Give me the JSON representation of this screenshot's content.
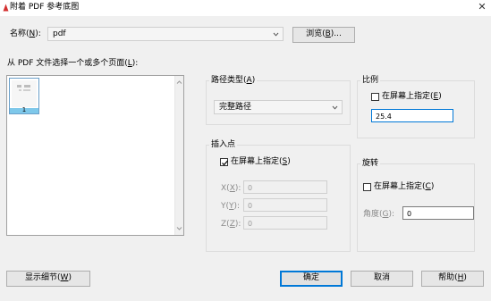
{
  "window": {
    "title": "附着 PDF 参考底图",
    "close_glyph": "✕"
  },
  "name_field": {
    "label": "名称(",
    "mnemonic": "N",
    "label_suffix": "):",
    "value": "pdf"
  },
  "browse_button": {
    "label": "浏览(",
    "mnemonic": "B",
    "suffix": ")..."
  },
  "pages": {
    "label": "从 PDF 文件选择一个或多个页面(",
    "mnemonic": "L",
    "suffix": "):",
    "thumbnails": [
      {
        "page_number": "1"
      }
    ]
  },
  "path_type": {
    "title": "路径类型(",
    "mnemonic": "A",
    "suffix": ")",
    "selected": "完整路径"
  },
  "scale": {
    "title": "比例",
    "specify_label": "在屏幕上指定(",
    "specify_mnemonic": "E",
    "specify_suffix": ")",
    "specify_checked": false,
    "value": "25.4"
  },
  "insertion_point": {
    "title": "插入点",
    "specify_label": "在屏幕上指定(",
    "specify_mnemonic": "S",
    "specify_suffix": ")",
    "specify_checked": true,
    "x": {
      "label": "X(",
      "mnemonic": "X",
      "suffix": "):",
      "value": "0"
    },
    "y": {
      "label": "Y(",
      "mnemonic": "Y",
      "suffix": "):",
      "value": "0"
    },
    "z": {
      "label": "Z(",
      "mnemonic": "Z",
      "suffix": "):",
      "value": "0"
    }
  },
  "rotation": {
    "title": "旋转",
    "specify_label": "在屏幕上指定(",
    "specify_mnemonic": "C",
    "specify_suffix": ")",
    "specify_checked": false,
    "angle": {
      "label": "角度(",
      "mnemonic": "G",
      "suffix": "):",
      "value": "0"
    }
  },
  "footer": {
    "details": {
      "label": "显示细节(",
      "mnemonic": "W",
      "suffix": ")"
    },
    "ok": {
      "label": "确定"
    },
    "cancel": {
      "label": "取消"
    },
    "help": {
      "label": "帮助(",
      "mnemonic": "H",
      "suffix": ")"
    }
  },
  "colors": {
    "accent": "#0078d7",
    "icon_red": "#d32f2f",
    "thumb_number_bg": "#7ec8ea"
  },
  "icons": {
    "app": "autocad-app-icon",
    "close": "close-icon",
    "dropdown": "chevron-down-icon",
    "scroll_up": "scroll-up-arrow-icon",
    "scroll_down": "scroll-down-arrow-icon",
    "check": "checkmark-icon"
  }
}
